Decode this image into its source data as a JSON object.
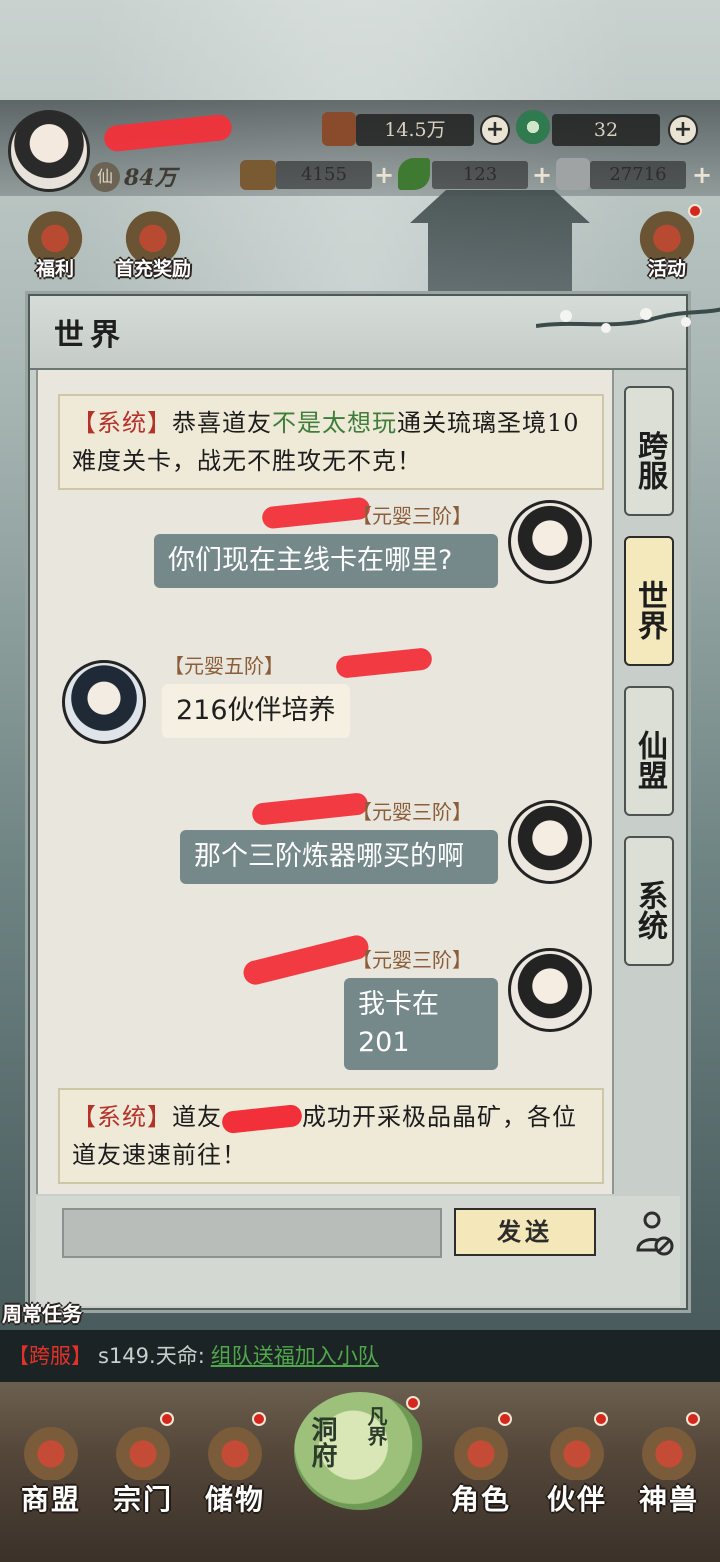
{
  "topbar": {
    "power": "84万",
    "copper": "14.5万",
    "jade": "32",
    "wood": "4155",
    "herb": "123",
    "iron": "27716"
  },
  "features": {
    "welfare": "福利",
    "first_recharge": "首充奖励",
    "activity": "活动"
  },
  "panel": {
    "title": "世界",
    "tabs": [
      "跨服",
      "世界",
      "仙盟",
      "系统"
    ],
    "active_tab": "世界",
    "send_label": "发送",
    "input_value": ""
  },
  "messages": {
    "sys1": {
      "tag": "【系统】",
      "part1": "恭喜道友",
      "highlight": "不是太想玩",
      "part2": "通关琉璃圣境10难度关卡，战无不胜攻无不克！"
    },
    "m1": {
      "rank": "【元婴三阶】",
      "text": "你们现在主线卡在哪里?"
    },
    "m2": {
      "rank": "【元婴五阶】",
      "text": "216伙伴培养"
    },
    "m3": {
      "rank": "【元婴三阶】",
      "text": "那个三阶炼器哪买的啊"
    },
    "m4": {
      "rank": "【元婴三阶】",
      "text": "我卡在201"
    },
    "sys2": {
      "tag": "【系统】",
      "part1": "道友",
      "part2": "成功开采极品晶矿，各位道友速速前往！"
    }
  },
  "ticker": {
    "tag": "【跨服】",
    "text": "s149.天命:",
    "link": "组队送福加入小队"
  },
  "weekly_label": "周常任务",
  "nav": {
    "items": [
      "商盟",
      "宗门",
      "储物",
      "角色",
      "伙伴",
      "神兽"
    ],
    "center_main": "洞府",
    "center_sub": "凡界"
  },
  "colors": {
    "system_tag": "#b5322a",
    "highlight_name": "#3f7d3a",
    "my_bubble": "#75898b",
    "active_tab": "#f4e9bd"
  }
}
